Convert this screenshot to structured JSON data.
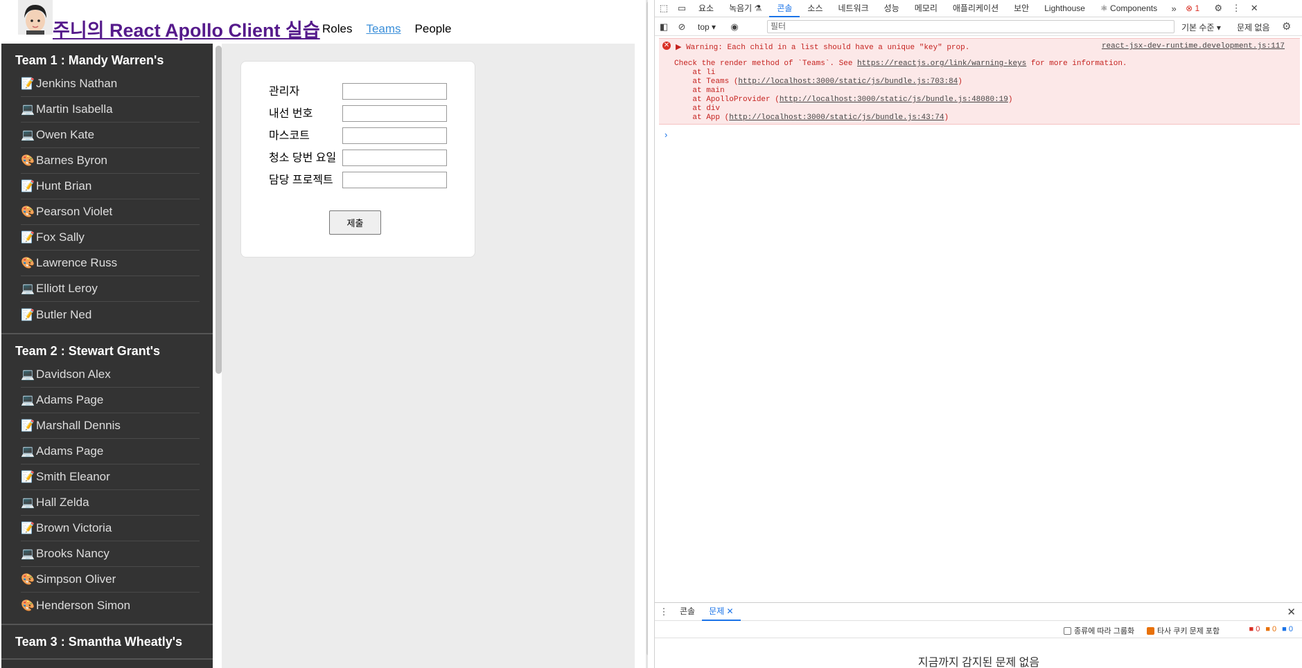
{
  "app": {
    "title": "주니의 React Apollo Client 실습",
    "nav": [
      {
        "label": "Roles",
        "active": false
      },
      {
        "label": "Teams",
        "active": true
      },
      {
        "label": "People",
        "active": false
      }
    ]
  },
  "teams": [
    {
      "title": "Team 1 : Mandy Warren's",
      "members": [
        {
          "icon": "📝",
          "name": "Jenkins Nathan"
        },
        {
          "icon": "💻",
          "name": "Martin Isabella"
        },
        {
          "icon": "💻",
          "name": "Owen Kate"
        },
        {
          "icon": "🎨",
          "name": "Barnes Byron"
        },
        {
          "icon": "📝",
          "name": "Hunt Brian"
        },
        {
          "icon": "🎨",
          "name": "Pearson Violet"
        },
        {
          "icon": "📝",
          "name": "Fox Sally"
        },
        {
          "icon": "🎨",
          "name": "Lawrence Russ"
        },
        {
          "icon": "💻",
          "name": "Elliott Leroy"
        },
        {
          "icon": "📝",
          "name": "Butler Ned"
        }
      ]
    },
    {
      "title": "Team 2 : Stewart Grant's",
      "members": [
        {
          "icon": "💻",
          "name": "Davidson Alex"
        },
        {
          "icon": "💻",
          "name": "Adams Page"
        },
        {
          "icon": "📝",
          "name": "Marshall Dennis"
        },
        {
          "icon": "💻",
          "name": "Adams Page"
        },
        {
          "icon": "📝",
          "name": "Smith Eleanor"
        },
        {
          "icon": "💻",
          "name": "Hall Zelda"
        },
        {
          "icon": "📝",
          "name": "Brown Victoria"
        },
        {
          "icon": "💻",
          "name": "Brooks Nancy"
        },
        {
          "icon": "🎨",
          "name": "Simpson Oliver"
        },
        {
          "icon": "🎨",
          "name": "Henderson Simon"
        }
      ]
    },
    {
      "title": "Team 3 : Smantha Wheatly's",
      "members": []
    }
  ],
  "form": {
    "fields": [
      {
        "label": "관리자",
        "value": ""
      },
      {
        "label": "내선 번호",
        "value": ""
      },
      {
        "label": "마스코트",
        "value": ""
      },
      {
        "label": "청소 당번 요일",
        "value": ""
      },
      {
        "label": "담당 프로젝트",
        "value": ""
      }
    ],
    "submit_label": "제출"
  },
  "devtools": {
    "tabs": [
      {
        "label": "요소",
        "active": false
      },
      {
        "label": "녹음기 ⚗",
        "active": false
      },
      {
        "label": "콘솔",
        "active": true
      },
      {
        "label": "소스",
        "active": false
      },
      {
        "label": "네트워크",
        "active": false
      },
      {
        "label": "성능",
        "active": false
      },
      {
        "label": "메모리",
        "active": false
      },
      {
        "label": "애플리케이션",
        "active": false
      },
      {
        "label": "보안",
        "active": false
      },
      {
        "label": "Lighthouse",
        "active": false
      },
      {
        "label": "⚛ Components",
        "active": false
      }
    ],
    "overflow": "»",
    "error_count": "1",
    "toolbar": {
      "context": "top ▾",
      "filter_placeholder": "필터",
      "level": "기본 수준 ▾",
      "issues": "문제 없음"
    },
    "console": {
      "warning_line": "Warning: Each child in a list should have a unique \"key\" prop.",
      "source": "react-jsx-dev-runtime.development.js:117",
      "body_prefix": "Check the render method of `Teams`. See ",
      "body_link": "https://reactjs.org/link/warning-keys",
      "body_suffix": " for more information.",
      "stack": [
        {
          "text": "    at li",
          "link": ""
        },
        {
          "text": "    at Teams (",
          "link": "http://localhost:3000/static/js/bundle.js:703:84",
          "tail": ")"
        },
        {
          "text": "    at main",
          "link": ""
        },
        {
          "text": "    at ApolloProvider (",
          "link": "http://localhost:3000/static/js/bundle.js:48080:19",
          "tail": ")"
        },
        {
          "text": "    at div",
          "link": ""
        },
        {
          "text": "    at App (",
          "link": "http://localhost:3000/static/js/bundle.js:43:74",
          "tail": ")"
        }
      ],
      "prompt": "›"
    },
    "drawer": {
      "tabs": [
        {
          "label": "콘솔",
          "active": false
        },
        {
          "label": "문제 ✕",
          "active": true
        }
      ],
      "group_by_kind": "종류에 따라 그룹화",
      "third_party": "타사 쿠키 문제 포함",
      "counts": [
        "0",
        "0",
        "0"
      ],
      "empty_message": "지금까지 감지된 문제 없음"
    }
  },
  "colors": {
    "sidebar_bg": "#333333",
    "active_link": "#3b8fd9",
    "title_visited": "#551a8b",
    "devtools_accent": "#1a73e8",
    "error_bg": "#fce8e8",
    "error_text": "#c5221f"
  }
}
